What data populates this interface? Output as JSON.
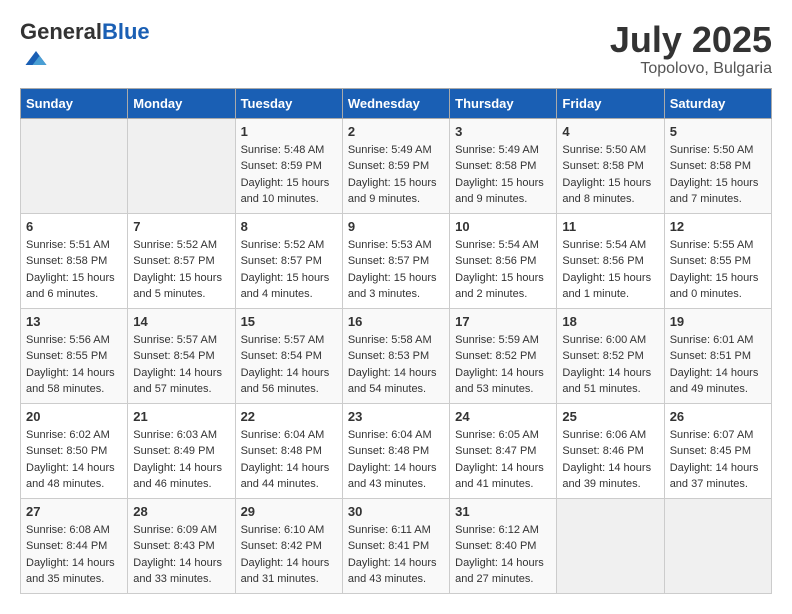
{
  "header": {
    "logo_general": "General",
    "logo_blue": "Blue",
    "month": "July 2025",
    "location": "Topolovo, Bulgaria"
  },
  "weekdays": [
    "Sunday",
    "Monday",
    "Tuesday",
    "Wednesday",
    "Thursday",
    "Friday",
    "Saturday"
  ],
  "weeks": [
    [
      {
        "day": "",
        "sunrise": "",
        "sunset": "",
        "daylight": "",
        "empty": true
      },
      {
        "day": "",
        "sunrise": "",
        "sunset": "",
        "daylight": "",
        "empty": true
      },
      {
        "day": "1",
        "sunrise": "Sunrise: 5:48 AM",
        "sunset": "Sunset: 8:59 PM",
        "daylight": "Daylight: 15 hours and 10 minutes."
      },
      {
        "day": "2",
        "sunrise": "Sunrise: 5:49 AM",
        "sunset": "Sunset: 8:59 PM",
        "daylight": "Daylight: 15 hours and 9 minutes."
      },
      {
        "day": "3",
        "sunrise": "Sunrise: 5:49 AM",
        "sunset": "Sunset: 8:58 PM",
        "daylight": "Daylight: 15 hours and 9 minutes."
      },
      {
        "day": "4",
        "sunrise": "Sunrise: 5:50 AM",
        "sunset": "Sunset: 8:58 PM",
        "daylight": "Daylight: 15 hours and 8 minutes."
      },
      {
        "day": "5",
        "sunrise": "Sunrise: 5:50 AM",
        "sunset": "Sunset: 8:58 PM",
        "daylight": "Daylight: 15 hours and 7 minutes."
      }
    ],
    [
      {
        "day": "6",
        "sunrise": "Sunrise: 5:51 AM",
        "sunset": "Sunset: 8:58 PM",
        "daylight": "Daylight: 15 hours and 6 minutes."
      },
      {
        "day": "7",
        "sunrise": "Sunrise: 5:52 AM",
        "sunset": "Sunset: 8:57 PM",
        "daylight": "Daylight: 15 hours and 5 minutes."
      },
      {
        "day": "8",
        "sunrise": "Sunrise: 5:52 AM",
        "sunset": "Sunset: 8:57 PM",
        "daylight": "Daylight: 15 hours and 4 minutes."
      },
      {
        "day": "9",
        "sunrise": "Sunrise: 5:53 AM",
        "sunset": "Sunset: 8:57 PM",
        "daylight": "Daylight: 15 hours and 3 minutes."
      },
      {
        "day": "10",
        "sunrise": "Sunrise: 5:54 AM",
        "sunset": "Sunset: 8:56 PM",
        "daylight": "Daylight: 15 hours and 2 minutes."
      },
      {
        "day": "11",
        "sunrise": "Sunrise: 5:54 AM",
        "sunset": "Sunset: 8:56 PM",
        "daylight": "Daylight: 15 hours and 1 minute."
      },
      {
        "day": "12",
        "sunrise": "Sunrise: 5:55 AM",
        "sunset": "Sunset: 8:55 PM",
        "daylight": "Daylight: 15 hours and 0 minutes."
      }
    ],
    [
      {
        "day": "13",
        "sunrise": "Sunrise: 5:56 AM",
        "sunset": "Sunset: 8:55 PM",
        "daylight": "Daylight: 14 hours and 58 minutes."
      },
      {
        "day": "14",
        "sunrise": "Sunrise: 5:57 AM",
        "sunset": "Sunset: 8:54 PM",
        "daylight": "Daylight: 14 hours and 57 minutes."
      },
      {
        "day": "15",
        "sunrise": "Sunrise: 5:57 AM",
        "sunset": "Sunset: 8:54 PM",
        "daylight": "Daylight: 14 hours and 56 minutes."
      },
      {
        "day": "16",
        "sunrise": "Sunrise: 5:58 AM",
        "sunset": "Sunset: 8:53 PM",
        "daylight": "Daylight: 14 hours and 54 minutes."
      },
      {
        "day": "17",
        "sunrise": "Sunrise: 5:59 AM",
        "sunset": "Sunset: 8:52 PM",
        "daylight": "Daylight: 14 hours and 53 minutes."
      },
      {
        "day": "18",
        "sunrise": "Sunrise: 6:00 AM",
        "sunset": "Sunset: 8:52 PM",
        "daylight": "Daylight: 14 hours and 51 minutes."
      },
      {
        "day": "19",
        "sunrise": "Sunrise: 6:01 AM",
        "sunset": "Sunset: 8:51 PM",
        "daylight": "Daylight: 14 hours and 49 minutes."
      }
    ],
    [
      {
        "day": "20",
        "sunrise": "Sunrise: 6:02 AM",
        "sunset": "Sunset: 8:50 PM",
        "daylight": "Daylight: 14 hours and 48 minutes."
      },
      {
        "day": "21",
        "sunrise": "Sunrise: 6:03 AM",
        "sunset": "Sunset: 8:49 PM",
        "daylight": "Daylight: 14 hours and 46 minutes."
      },
      {
        "day": "22",
        "sunrise": "Sunrise: 6:04 AM",
        "sunset": "Sunset: 8:48 PM",
        "daylight": "Daylight: 14 hours and 44 minutes."
      },
      {
        "day": "23",
        "sunrise": "Sunrise: 6:04 AM",
        "sunset": "Sunset: 8:48 PM",
        "daylight": "Daylight: 14 hours and 43 minutes."
      },
      {
        "day": "24",
        "sunrise": "Sunrise: 6:05 AM",
        "sunset": "Sunset: 8:47 PM",
        "daylight": "Daylight: 14 hours and 41 minutes."
      },
      {
        "day": "25",
        "sunrise": "Sunrise: 6:06 AM",
        "sunset": "Sunset: 8:46 PM",
        "daylight": "Daylight: 14 hours and 39 minutes."
      },
      {
        "day": "26",
        "sunrise": "Sunrise: 6:07 AM",
        "sunset": "Sunset: 8:45 PM",
        "daylight": "Daylight: 14 hours and 37 minutes."
      }
    ],
    [
      {
        "day": "27",
        "sunrise": "Sunrise: 6:08 AM",
        "sunset": "Sunset: 8:44 PM",
        "daylight": "Daylight: 14 hours and 35 minutes."
      },
      {
        "day": "28",
        "sunrise": "Sunrise: 6:09 AM",
        "sunset": "Sunset: 8:43 PM",
        "daylight": "Daylight: 14 hours and 33 minutes."
      },
      {
        "day": "29",
        "sunrise": "Sunrise: 6:10 AM",
        "sunset": "Sunset: 8:42 PM",
        "daylight": "Daylight: 14 hours and 31 minutes."
      },
      {
        "day": "30",
        "sunrise": "Sunrise: 6:11 AM",
        "sunset": "Sunset: 8:41 PM",
        "daylight": "Daylight: 14 hours and 43 minutes."
      },
      {
        "day": "31",
        "sunrise": "Sunrise: 6:12 AM",
        "sunset": "Sunset: 8:40 PM",
        "daylight": "Daylight: 14 hours and 27 minutes."
      },
      {
        "day": "",
        "sunrise": "",
        "sunset": "",
        "daylight": "",
        "empty": true
      },
      {
        "day": "",
        "sunrise": "",
        "sunset": "",
        "daylight": "",
        "empty": true
      }
    ]
  ]
}
